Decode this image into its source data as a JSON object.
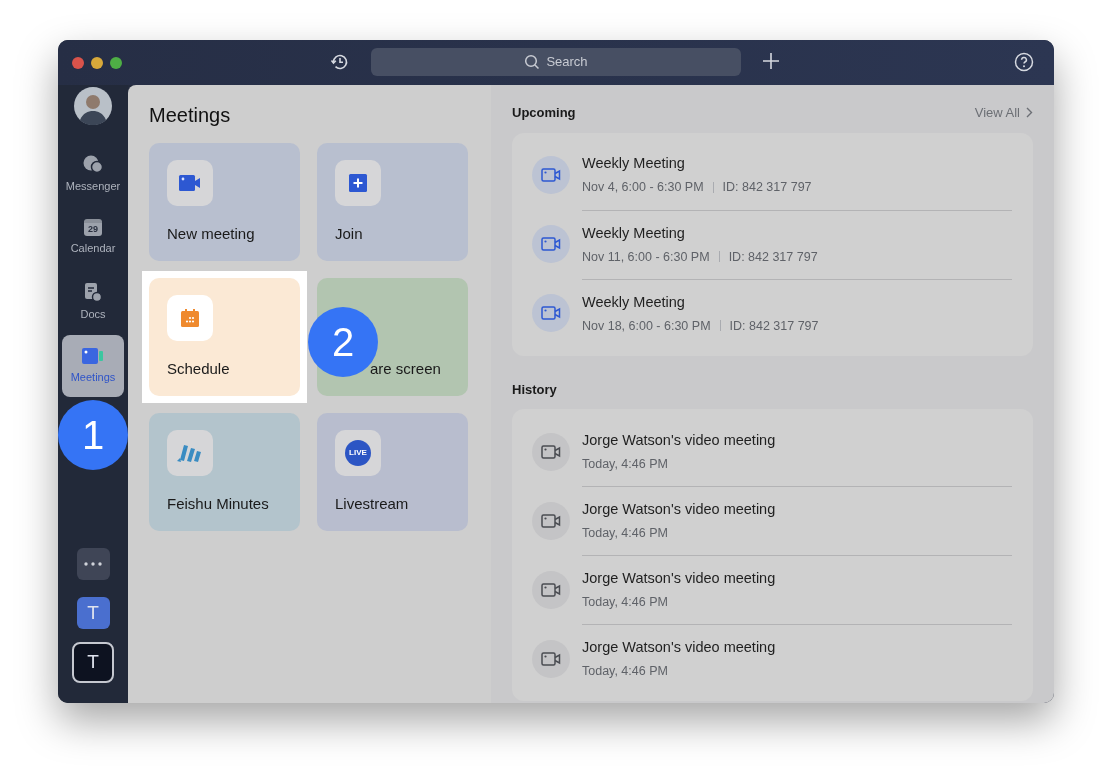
{
  "search": {
    "placeholder": "Search"
  },
  "sidebar": {
    "items": [
      {
        "label": "Messenger",
        "kind": "chat",
        "selected": false
      },
      {
        "label": "Calendar",
        "kind": "calendar",
        "date": "29",
        "selected": false
      },
      {
        "label": "Docs",
        "kind": "docs",
        "selected": false
      },
      {
        "label": "Meetings",
        "kind": "meetings",
        "selected": true
      }
    ],
    "apps": [
      {
        "letter": "T",
        "kind": "workspace",
        "selected": false
      },
      {
        "letter": "T",
        "kind": "workspace",
        "selected": true
      }
    ]
  },
  "meetings": {
    "title": "Meetings",
    "tiles": [
      {
        "label": "New meeting",
        "kind": "new",
        "color": "#b8bfcf",
        "highlighted": false
      },
      {
        "label": "Join",
        "kind": "join",
        "color": "#b8bfcf",
        "highlighted": false
      },
      {
        "label": "Schedule",
        "kind": "schedule",
        "color": "#fbe9d5",
        "highlighted": true
      },
      {
        "label": "are screen",
        "kind": "share",
        "color": "#b2c5b0",
        "highlighted": false
      },
      {
        "label": "Feishu Minutes",
        "kind": "minutes",
        "color": "#b3c4cc",
        "highlighted": false
      },
      {
        "label": "Livestream",
        "kind": "live",
        "icon_text": "LIVE",
        "color": "#b8bdce",
        "highlighted": false
      }
    ]
  },
  "upcoming": {
    "title": "Upcoming",
    "view_all": "View All",
    "items": [
      {
        "title": "Weekly Meeting",
        "time": "Nov 4, 6:00 - 6:30 PM",
        "id": "ID: 842 317 797"
      },
      {
        "title": "Weekly Meeting",
        "time": "Nov 11, 6:00 - 6:30 PM",
        "id": "ID: 842 317 797"
      },
      {
        "title": "Weekly Meeting",
        "time": "Nov 18, 6:00 - 6:30 PM",
        "id": "ID: 842 317 797"
      }
    ]
  },
  "history": {
    "title": "History",
    "items": [
      {
        "title": "Jorge Watson's video meeting",
        "time": "Today, 4:46 PM"
      },
      {
        "title": "Jorge Watson's video meeting",
        "time": "Today, 4:46 PM"
      },
      {
        "title": "Jorge Watson's video meeting",
        "time": "Today, 4:46 PM"
      },
      {
        "title": "Jorge Watson's video meeting",
        "time": "Today, 4:46 PM"
      }
    ]
  },
  "callouts": [
    "1",
    "2"
  ]
}
